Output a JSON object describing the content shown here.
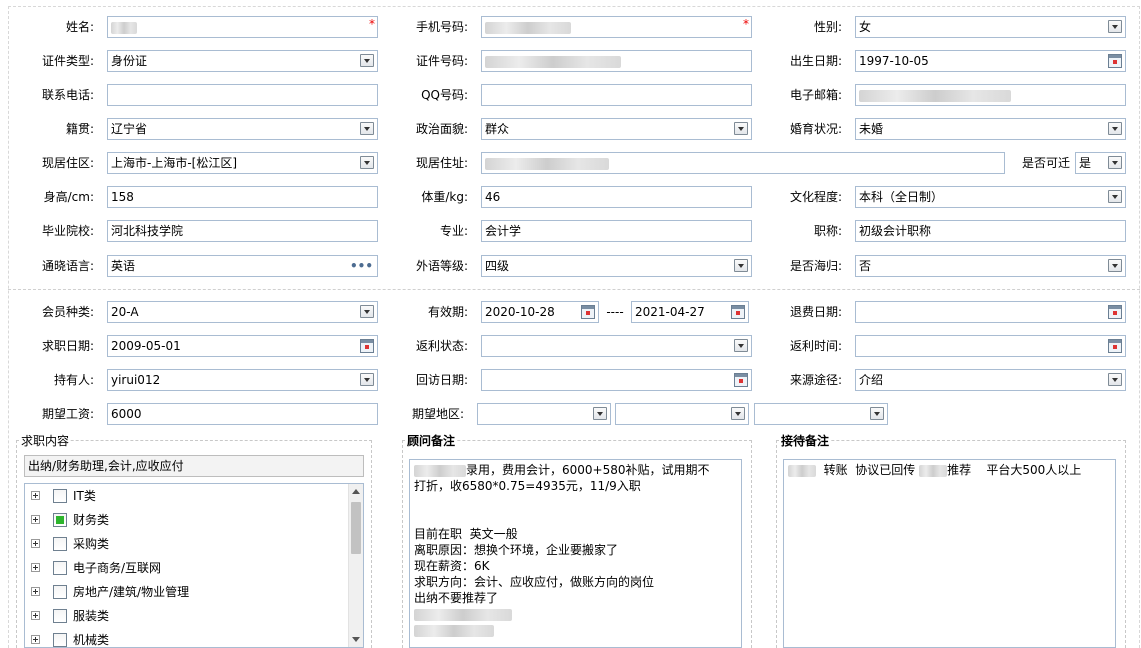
{
  "profile": {
    "name_label": "姓名:",
    "phone_label": "手机号码:",
    "gender_label": "性别:",
    "gender_value": "女",
    "idtype_label": "证件类型:",
    "idtype_value": "身份证",
    "idnum_label": "证件号码:",
    "birth_label": "出生日期:",
    "birth_value": "1997-10-05",
    "contact_label": "联系电话:",
    "qq_label": "QQ号码:",
    "email_label": "电子邮箱:",
    "origin_label": "籍贯:",
    "origin_value": "辽宁省",
    "political_label": "政治面貌:",
    "political_value": "群众",
    "marital_label": "婚育状况:",
    "marital_value": "未婚",
    "residence_label": "现居住区:",
    "residence_value": "上海市-上海市-[松江区]",
    "address_label": "现居住址:",
    "relocate_label": "是否可迁",
    "relocate_value": "是",
    "height_label": "身高/cm:",
    "height_value": "158",
    "weight_label": "体重/kg:",
    "weight_value": "46",
    "edu_label": "文化程度:",
    "edu_value": "本科（全日制）",
    "school_label": "毕业院校:",
    "school_value": "河北科技学院",
    "major_label": "专业:",
    "major_value": "会计学",
    "title_label": "职称:",
    "title_value": "初级会计职称",
    "lang_label": "通晓语言:",
    "lang_value": "英语",
    "lang_more": "•••",
    "level_label": "外语等级:",
    "level_value": "四级",
    "abroad_label": "是否海归:",
    "abroad_value": "否"
  },
  "membership": {
    "type_label": "会员种类:",
    "type_value": "20-A",
    "valid_label": "有效期:",
    "valid_from": "2020-10-28",
    "valid_sep": "----",
    "valid_to": "2021-04-27",
    "refund_label": "退费日期:",
    "jobdate_label": "求职日期:",
    "jobdate_value": "2009-05-01",
    "rebate_status_label": "返利状态:",
    "rebate_time_label": "返利时间:",
    "holder_label": "持有人:",
    "holder_value": "yirui012",
    "visit_label": "回访日期:",
    "source_label": "来源途径:",
    "source_value": "介绍",
    "salary_label": "期望工资:",
    "salary_value": "6000",
    "area_label": "期望地区:"
  },
  "job_content": {
    "title": "求职内容",
    "summary": "出纳/财务助理,会计,应收应付",
    "tree": [
      {
        "label": "IT类",
        "state": "none"
      },
      {
        "label": "财务类",
        "state": "partial"
      },
      {
        "label": "采购类",
        "state": "none"
      },
      {
        "label": "电子商务/互联网",
        "state": "none"
      },
      {
        "label": "房地产/建筑/物业管理",
        "state": "none"
      },
      {
        "label": "服装类",
        "state": "none"
      },
      {
        "label": "机械类",
        "state": "none"
      }
    ]
  },
  "consultant_note": {
    "title": "顾问备注",
    "line1": "录用，费用会计，6000+580补贴，试用期不",
    "line2": "打折，收6580*0.75=4935元，11/9入职",
    "line3": "目前在职  英文一般",
    "line4": "离职原因：想换个环境，企业要搬家了",
    "line5": "现在薪资：6K",
    "line6": "求职方向：会计、应收应付，做账方向的岗位",
    "line7": "出纳不要推荐了"
  },
  "reception_note": {
    "title": "接待备注",
    "part1": "转账  协议已回传",
    "part2": "推荐    平台大500人以上"
  }
}
